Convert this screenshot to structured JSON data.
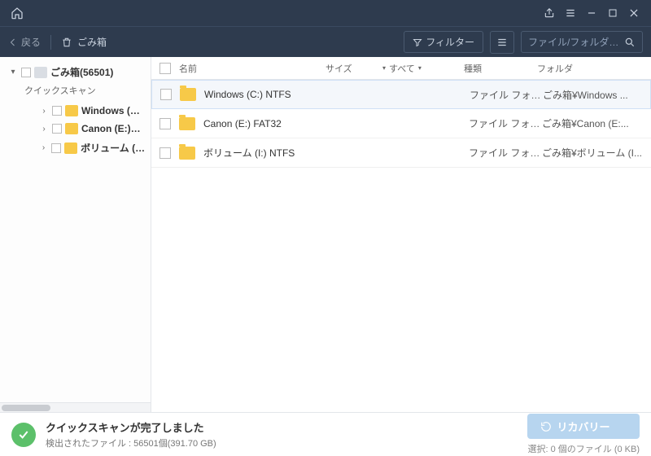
{
  "titlebar": {},
  "toolbar": {
    "back": "戻る",
    "trash_label": "ごみ箱",
    "filter": "フィルター",
    "search_placeholder": "ファイル/フォルダーを検索"
  },
  "sidebar": {
    "root_label": "ごみ箱(56501)",
    "quick_scan": "クイックスキャン",
    "children": [
      {
        "label": "Windows (…"
      },
      {
        "label": "Canon (E:)…"
      },
      {
        "label": "ボリューム (I:…"
      }
    ]
  },
  "columns": {
    "name": "名前",
    "size": "サイズ",
    "all": "すべて",
    "type": "種類",
    "folder": "フォルダ"
  },
  "rows": [
    {
      "name": "Windows (C:) NTFS",
      "type": "ファイル フォ…",
      "folder": "ごみ箱¥Windows ...",
      "hl": true
    },
    {
      "name": "Canon (E:) FAT32",
      "type": "ファイル フォ…",
      "folder": "ごみ箱¥Canon (E:..."
    },
    {
      "name": "ボリューム (I:) NTFS",
      "type": "ファイル フォ…",
      "folder": "ごみ箱¥ボリューム (I..."
    }
  ],
  "status": {
    "title": "クイックスキャンが完了しました",
    "detected": "検出されたファイル : 56501個(391.70 GB)",
    "recover": "リカバリー",
    "selection": "選択: 0 個のファイル (0 KB)"
  }
}
